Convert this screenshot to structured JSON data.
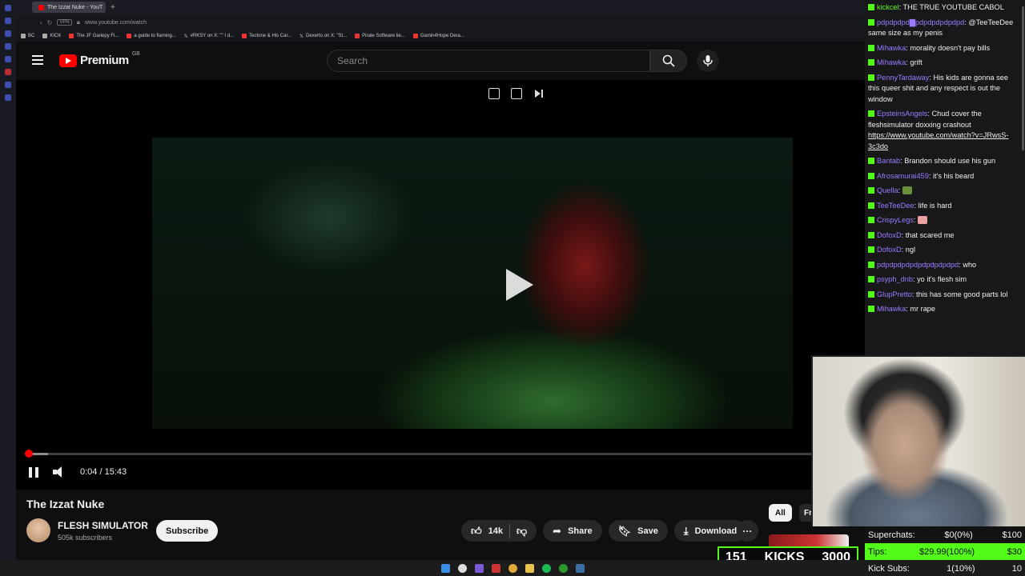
{
  "browser": {
    "tab_title": "The Izzat Nuke - YouT",
    "url": "www.youtube.com/watch",
    "vpn_label": "VPN",
    "bookmarks": [
      {
        "label": "BC",
        "icon": "folder-icon"
      },
      {
        "label": "KICK",
        "icon": "folder-icon"
      },
      {
        "label": "The JF Gariepy Fi...",
        "icon": "youtube-icon"
      },
      {
        "label": "a guide to flaming...",
        "icon": "youtube-icon"
      },
      {
        "label": "#RKSY on X: \"\" I d...",
        "icon": "x-icon"
      },
      {
        "label": "Tectone & His Car...",
        "icon": "youtube-icon"
      },
      {
        "label": "Dexerto on X: \"St...",
        "icon": "x-icon"
      },
      {
        "label": "Pirate Software lie...",
        "icon": "youtube-icon"
      },
      {
        "label": "Gamin4Hope Dera...",
        "icon": "youtube-icon"
      }
    ]
  },
  "youtube": {
    "logo_text": "Premium",
    "region": "GB",
    "search_placeholder": "Search",
    "player": {
      "time": "0:04 / 15:43",
      "progress_fraction": 0.0043,
      "buffered_fraction": 0.027
    },
    "video_title": "The Izzat Nuke",
    "channel_name": "FLESH SIMULATOR",
    "subscribers": "505k subscribers",
    "subscribe_label": "Subscribe",
    "likes": "14k",
    "share_label": "Share",
    "save_label": "Save",
    "download_label": "Download",
    "chips": [
      "All",
      "Fr"
    ]
  },
  "chat": [
    {
      "user": "kickcel",
      "user_color": "#53fc18",
      "text": "THE TRUE YOUTUBE CABOL"
    },
    {
      "user": "pdpdpdpd▇pdpdpdpdpdpd",
      "text": "@TeeTeeDee same size as my penis"
    },
    {
      "user": "Mihawka",
      "text": "morality doesn't pay bills"
    },
    {
      "user": "Mihawka",
      "text": "grift"
    },
    {
      "user": "PennyTardaway",
      "text": "His kids are gonna see this queer shit and any respect is out the window"
    },
    {
      "user": "EpsteinsAngels",
      "text": "Chud cover the fleshsimulator doxxing crashout",
      "link": "https://www.youtube.com/watch?v=JRwsS-3c3do"
    },
    {
      "user": "Bantab",
      "text": "Brandon should use his gun"
    },
    {
      "user": "Afrosamurai459",
      "text": "it's his beard"
    },
    {
      "user": "Quella",
      "emote": "#6a8f3a",
      "text": ""
    },
    {
      "user": "TeeTeeDee",
      "text": "life is hard"
    },
    {
      "user": "CrispyLegs",
      "emote": "#e8a0a0",
      "text": ""
    },
    {
      "user": "DofoxD",
      "text": "that scared me"
    },
    {
      "user": "DofoxD",
      "text": "ngl"
    },
    {
      "user": "pdpdpdpdpdpdpdpdpdpd",
      "text": "who"
    },
    {
      "user": "psyph_dnb",
      "text": "yo it's flesh sim"
    },
    {
      "user": "GlupPretto",
      "text": "this has some good parts lol"
    },
    {
      "user": "Mihawka",
      "text": "mr rape"
    }
  ],
  "overlay": {
    "count": "151",
    "kicks_label": "KICKS",
    "kicks_goal": "3000",
    "stats": [
      {
        "label": "Superchats:",
        "value": "$0(0%)",
        "goal": "$100",
        "fraction": 0
      },
      {
        "label": "Tips:",
        "value": "$29.99(100%)",
        "goal": "$30",
        "fraction": 1
      },
      {
        "label": "Kick Subs:",
        "value": "1(10%)",
        "goal": "10",
        "fraction": 0.1
      }
    ]
  },
  "colors": {
    "accent_red": "#ff0000",
    "kick_green": "#53fc18",
    "chat_user": "#9b7bff"
  }
}
